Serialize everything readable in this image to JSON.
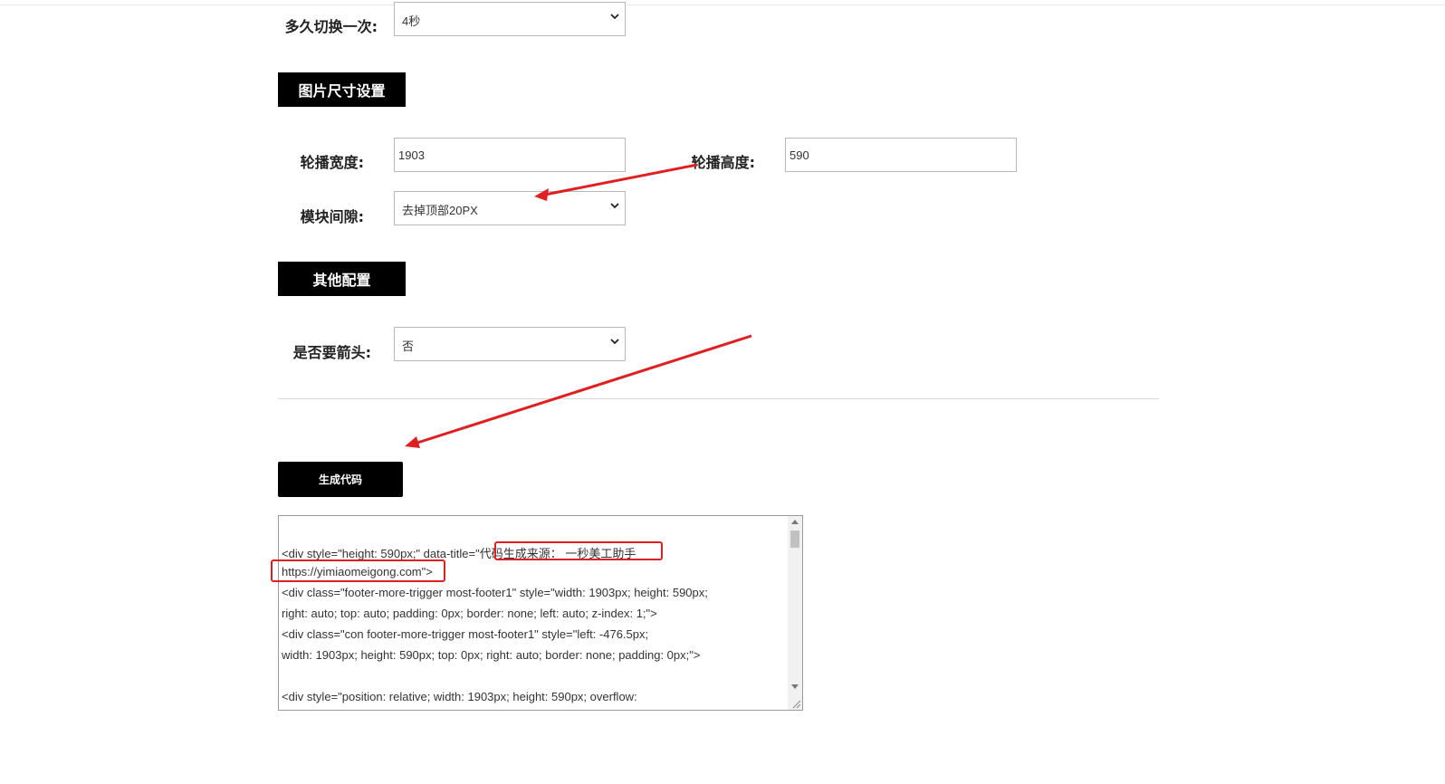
{
  "interval": {
    "label": "多久切换一次:",
    "value": "4秒"
  },
  "size_section": {
    "title": "图片尺寸设置"
  },
  "width": {
    "label": "轮播宽度:",
    "value": "1903"
  },
  "height": {
    "label": "轮播高度:",
    "value": "590"
  },
  "gap": {
    "label": "模块间隙:",
    "value": "去掉顶部20PX"
  },
  "other_section": {
    "title": "其他配置"
  },
  "arrows": {
    "label": "是否要箭头:",
    "value": "否"
  },
  "generate": {
    "label": "生成代码"
  },
  "code": {
    "lines": [
      "<div style=\"height: 590px;\" data-title=\"代码生成来源：  一秒美工助手",
      "https://yimiaomeigong.com\">",
      "        <div class=\"footer-more-trigger most-footer1\" style=\"width: 1903px; height: 590px;",
      "right: auto; top: auto; padding: 0px; border: none; left: auto; z-index: 1;\">",
      "                        <div class=\"con footer-more-trigger most-footer1\" style=\"left: -476.5px;",
      "width: 1903px; height: 590px; top: 0px; right: auto; border: none; padding: 0px;\">",
      "",
      "                                <div style=\"position: relative; width: 1903px; height: 590px; overflow:"
    ]
  },
  "colors": {
    "accent": "#e02020",
    "button_bg": "#000000"
  }
}
